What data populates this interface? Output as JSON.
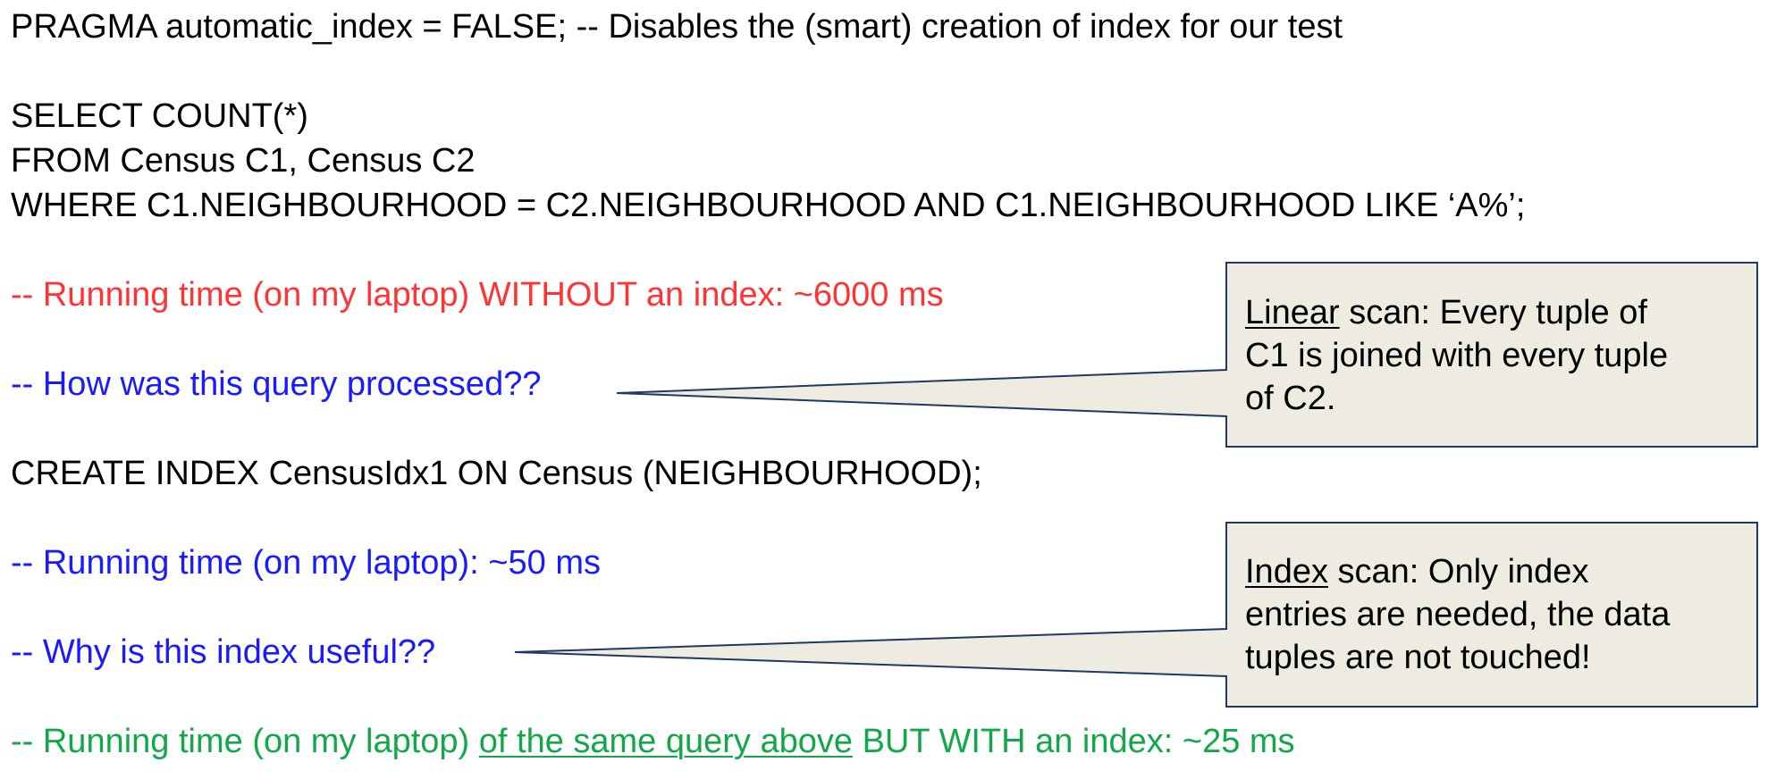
{
  "lines": {
    "pragma": "PRAGMA automatic_index = FALSE; -- Disables the (smart) creation of index for our test",
    "select": "SELECT COUNT(*)",
    "from": "FROM Census C1, Census C2",
    "where": "WHERE C1.NEIGHBOURHOOD = C2.NEIGHBOURHOOD AND C1.NEIGHBOURHOOD LIKE ‘A%’;",
    "running_without_index": "-- Running time (on my laptop) WITHOUT an index: ~6000 ms",
    "how_processed": "-- How was this query processed??",
    "create_index": "CREATE INDEX CensusIdx1 ON Census (NEIGHBOURHOOD);",
    "running_with_index": "-- Running time (on my laptop): ~50 ms",
    "why_useful": "-- Why is this index useful??",
    "running_same_query_prefix": "-- Running time (on my laptop) ",
    "running_same_query_underlined": "of the same query above",
    "running_same_query_suffix": " BUT WITH an index: ~25 ms"
  },
  "callouts": {
    "linear": {
      "keyword": "Linear",
      "line1_rest": " scan: Every tuple of",
      "line2": "C1 is joined with every tuple",
      "line3": "of C2."
    },
    "index": {
      "keyword": "Index",
      "line1_rest": " scan: Only index",
      "line2": "entries are needed, the data",
      "line3": "tuples are not touched!"
    }
  },
  "colors": {
    "black": "#000000",
    "red": "#ff3333",
    "blue": "#1a1aff",
    "green": "#12a84a",
    "callout_fill": "#eeebe0",
    "callout_border": "#1f3864"
  }
}
